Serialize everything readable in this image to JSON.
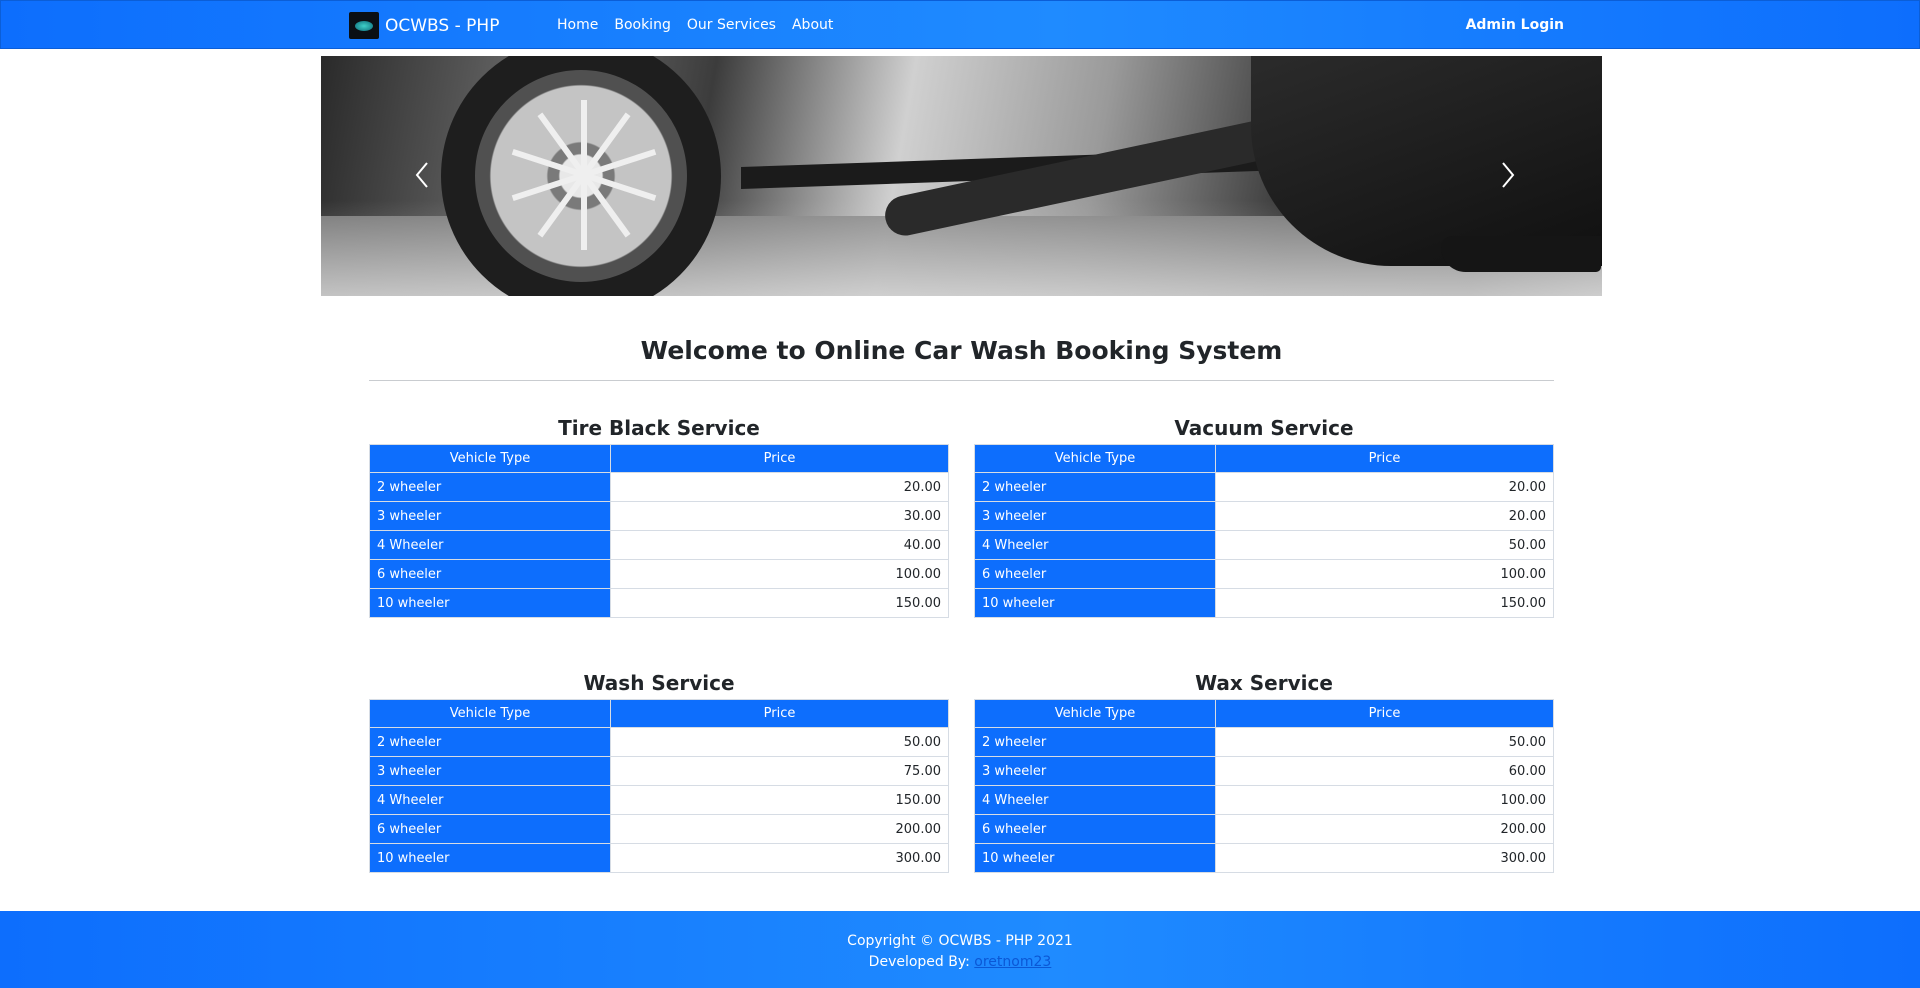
{
  "navbar": {
    "brand": "OCWBS - PHP",
    "links": [
      "Home",
      "Booking",
      "Our Services",
      "About"
    ],
    "admin_login": "Admin Login",
    "logo_icon": "car-wash-logo-icon"
  },
  "carousel": {
    "prev_icon": "chevron-left-icon",
    "next_icon": "chevron-right-icon"
  },
  "main": {
    "welcome": "Welcome to Online Car Wash Booking System"
  },
  "services": [
    {
      "title": "Tire Black Service",
      "headers": [
        "Vehicle Type",
        "Price"
      ],
      "rows": [
        {
          "type": "2 wheeler",
          "price": "20.00"
        },
        {
          "type": "3 wheeler",
          "price": "30.00"
        },
        {
          "type": "4 Wheeler",
          "price": "40.00"
        },
        {
          "type": "6 wheeler",
          "price": "100.00"
        },
        {
          "type": "10 wheeler",
          "price": "150.00"
        }
      ]
    },
    {
      "title": "Vacuum Service",
      "headers": [
        "Vehicle Type",
        "Price"
      ],
      "rows": [
        {
          "type": "2 wheeler",
          "price": "20.00"
        },
        {
          "type": "3 wheeler",
          "price": "20.00"
        },
        {
          "type": "4 Wheeler",
          "price": "50.00"
        },
        {
          "type": "6 wheeler",
          "price": "100.00"
        },
        {
          "type": "10 wheeler",
          "price": "150.00"
        }
      ]
    },
    {
      "title": "Wash Service",
      "headers": [
        "Vehicle Type",
        "Price"
      ],
      "rows": [
        {
          "type": "2 wheeler",
          "price": "50.00"
        },
        {
          "type": "3 wheeler",
          "price": "75.00"
        },
        {
          "type": "4 Wheeler",
          "price": "150.00"
        },
        {
          "type": "6 wheeler",
          "price": "200.00"
        },
        {
          "type": "10 wheeler",
          "price": "300.00"
        }
      ]
    },
    {
      "title": "Wax Service",
      "headers": [
        "Vehicle Type",
        "Price"
      ],
      "rows": [
        {
          "type": "2 wheeler",
          "price": "50.00"
        },
        {
          "type": "3 wheeler",
          "price": "60.00"
        },
        {
          "type": "4 Wheeler",
          "price": "100.00"
        },
        {
          "type": "6 wheeler",
          "price": "200.00"
        },
        {
          "type": "10 wheeler",
          "price": "300.00"
        }
      ]
    }
  ],
  "footer": {
    "copyright": "Copyright © OCWBS - PHP 2021",
    "developed_by_label": "Developed By:",
    "developer": "oretnom23"
  },
  "colors": {
    "primary": "#0d6efd",
    "text": "#212529",
    "border": "#d6dce4"
  }
}
